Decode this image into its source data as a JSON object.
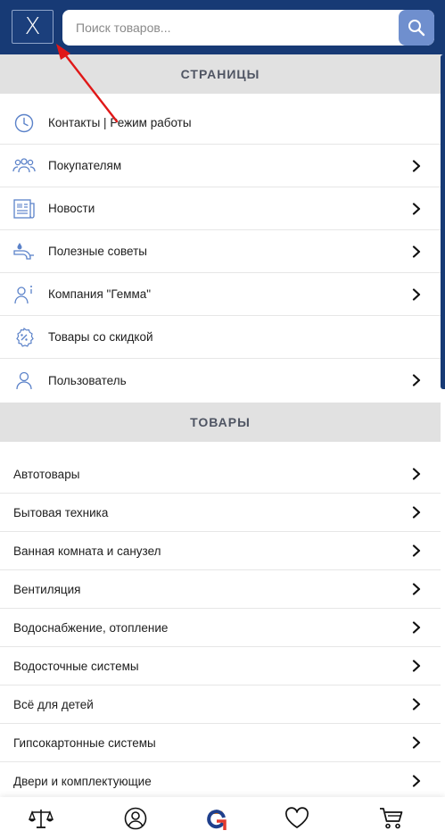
{
  "header": {
    "close_label": "X",
    "search": {
      "placeholder": "Поиск товаров...",
      "value": ""
    }
  },
  "pages": {
    "title": "СТРАНИЦЫ",
    "items": [
      {
        "label": "Контакты | Режим работы",
        "icon": "clock-icon",
        "has_arrow": false
      },
      {
        "label": "Покупателям",
        "icon": "customers-icon",
        "has_arrow": true
      },
      {
        "label": "Новости",
        "icon": "newspaper-icon",
        "has_arrow": true
      },
      {
        "label": "Полезные советы",
        "icon": "faucet-icon",
        "has_arrow": true
      },
      {
        "label": "Компания \"Гемма\"",
        "icon": "company-info-icon",
        "has_arrow": true
      },
      {
        "label": "Товары со скидкой",
        "icon": "discount-icon",
        "has_arrow": false
      },
      {
        "label": "Пользователь",
        "icon": "user-icon",
        "has_arrow": true
      }
    ]
  },
  "goods": {
    "title": "ТОВАРЫ",
    "items": [
      {
        "label": "Автотовары"
      },
      {
        "label": "Бытовая техника"
      },
      {
        "label": "Ванная комната и санузел"
      },
      {
        "label": "Вентиляция"
      },
      {
        "label": "Водоснабжение, отопление"
      },
      {
        "label": "Водосточные системы"
      },
      {
        "label": "Всё для детей"
      },
      {
        "label": "Гипсокартонные системы"
      },
      {
        "label": "Двери и комплектующие"
      }
    ]
  },
  "bottom_nav": {
    "items": [
      {
        "name": "compare-icon"
      },
      {
        "name": "account-icon"
      },
      {
        "name": "home-logo-icon"
      },
      {
        "name": "favorites-icon"
      },
      {
        "name": "cart-icon"
      }
    ]
  },
  "colors": {
    "header_bg": "#173a75",
    "search_button": "#6f8fce",
    "icon_blue": "#5b82c9",
    "section_bg": "#e1e1e1",
    "annotation_red": "#e01818"
  }
}
